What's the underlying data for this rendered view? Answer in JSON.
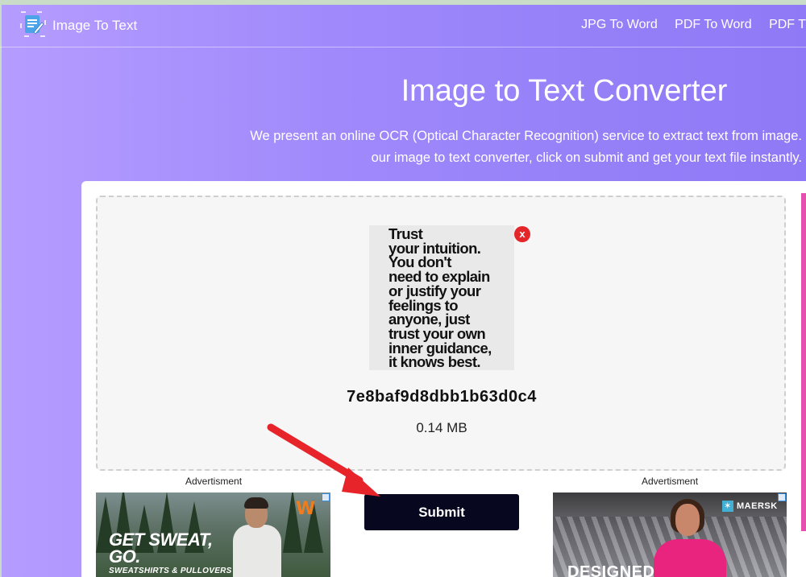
{
  "app": {
    "brand": "Image To Text",
    "nav": [
      "JPG To Word",
      "PDF To Word",
      "PDF T"
    ]
  },
  "hero": {
    "title": "Image to Text Converter",
    "desc_line1": "We present an online OCR (Optical Character Recognition) service to extract text from image.",
    "desc_line2": "our image to text converter, click on submit and get your text file instantly."
  },
  "upload": {
    "preview_lines": [
      "Trust",
      "your intuition.",
      "You don't",
      "need to explain",
      "or justify your",
      "feelings to",
      "anyone, just",
      "trust your own",
      "inner guidance,",
      "it knows best."
    ],
    "remove_label": "x",
    "filename": "7e8baf9d8dbb1b63d0c4",
    "filesize": "0.14 MB"
  },
  "actions": {
    "submit_label": "Submit"
  },
  "ads": {
    "label": "Advertisment",
    "left": {
      "headline_line1": "GET SWEAT,",
      "headline_line2": "GO.",
      "sub": "SWEATSHIRTS & PULLOVERS",
      "logo": "W"
    },
    "right": {
      "brand": "MAERSK",
      "headline": "DESIGNED"
    }
  },
  "colors": {
    "header_gradient_start": "#b59cff",
    "header_gradient_end": "#8f79f6",
    "submit_bg": "#070720",
    "remove_red": "#e4262b",
    "arrow_red": "#e8242b"
  }
}
